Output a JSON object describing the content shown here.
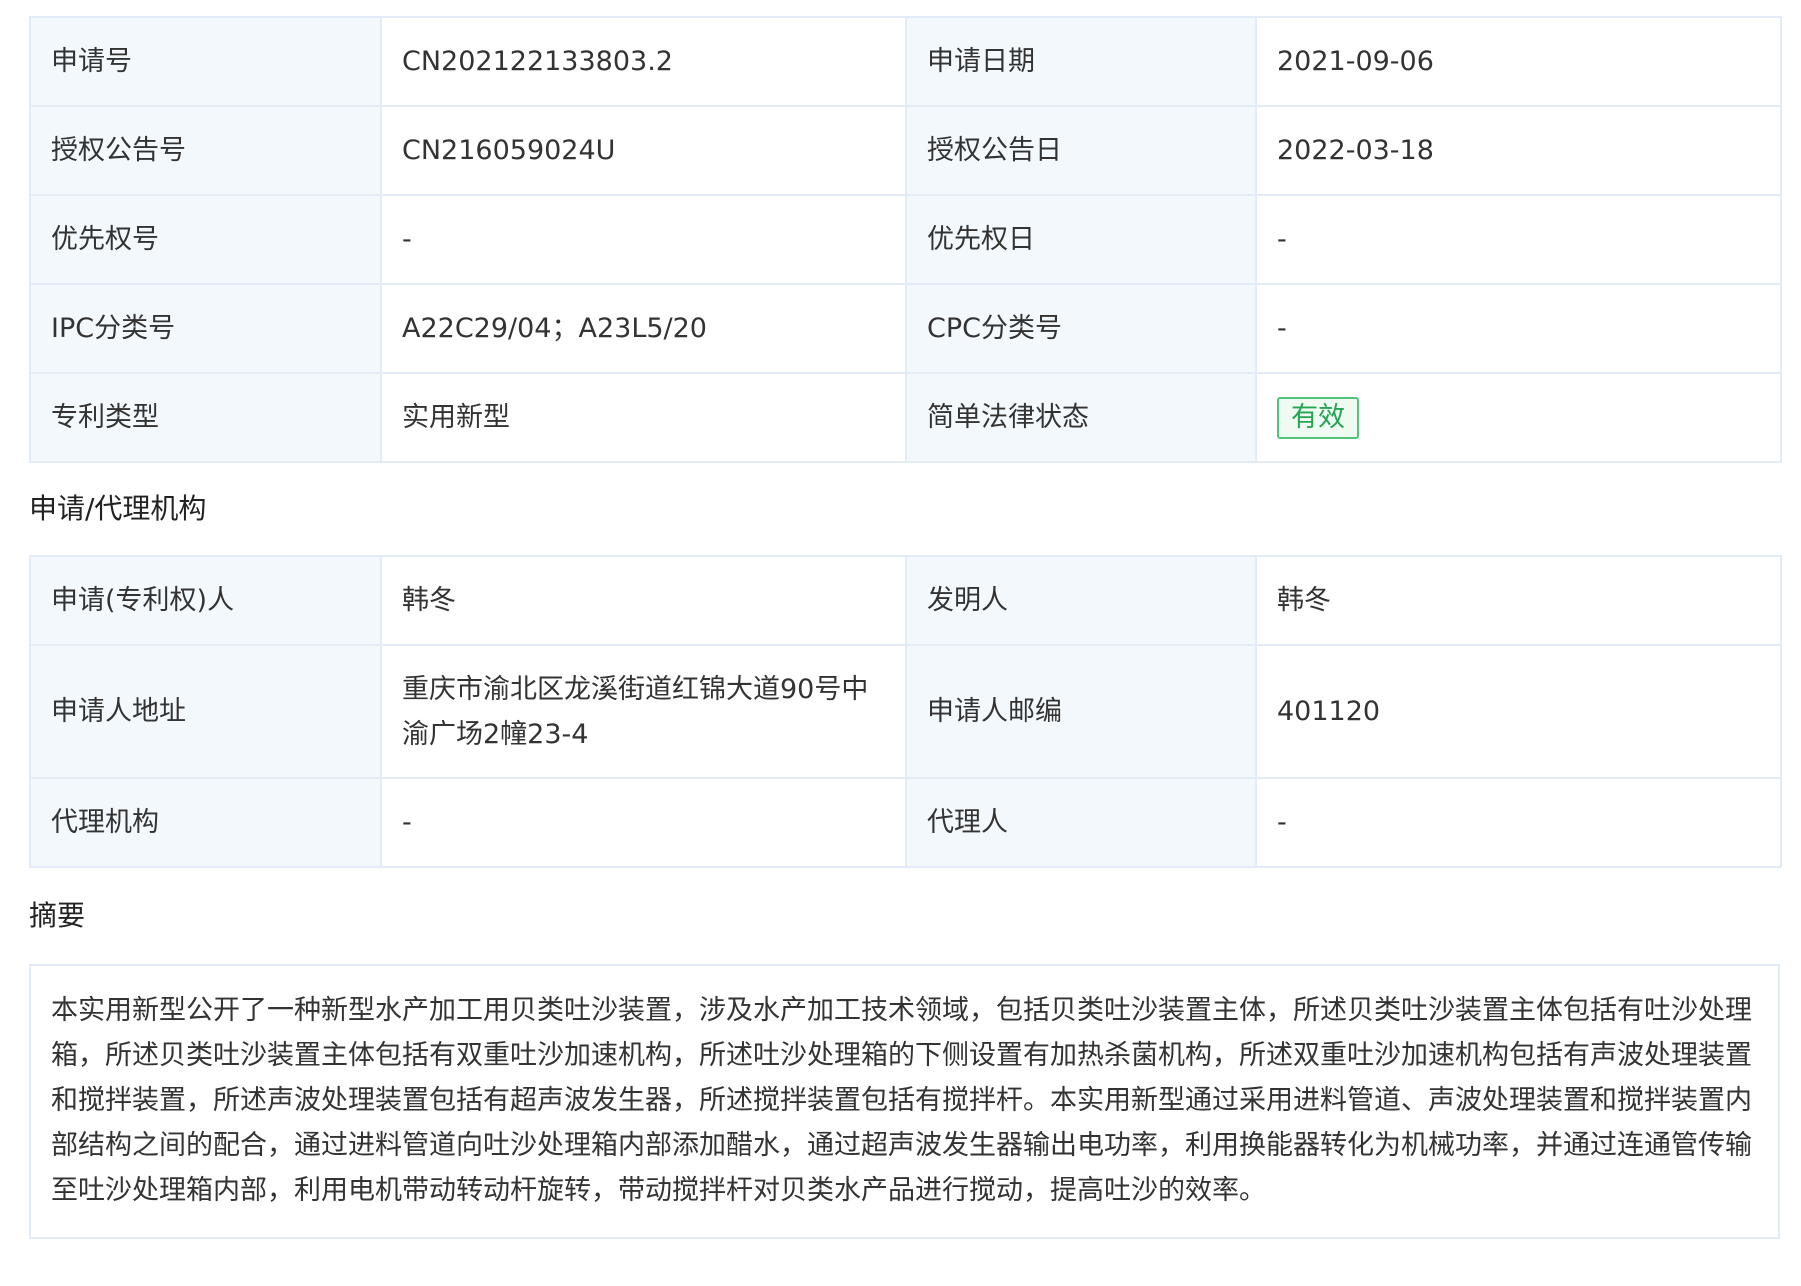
{
  "basic": {
    "rows": [
      {
        "k1": "申请号",
        "v1": "CN202122133803.2",
        "k2": "申请日期",
        "v2": "2021-09-06"
      },
      {
        "k1": "授权公告号",
        "v1": "CN216059024U",
        "k2": "授权公告日",
        "v2": "2022-03-18"
      },
      {
        "k1": "优先权号",
        "v1": "-",
        "k2": "优先权日",
        "v2": "-"
      },
      {
        "k1": "IPC分类号",
        "v1": "A22C29/04；A23L5/20",
        "k2": "CPC分类号",
        "v2": "-"
      },
      {
        "k1": "专利类型",
        "v1": "实用新型",
        "k2": "简单法律状态",
        "v2": "有效"
      }
    ],
    "status_color": "#24a552"
  },
  "applicant_section": {
    "title": "申请/代理机构",
    "rows": [
      {
        "k1": "申请(专利权)人",
        "v1": "韩冬",
        "k2": "发明人",
        "v2": "韩冬"
      },
      {
        "k1": "申请人地址",
        "v1": "重庆市渝北区龙溪街道红锦大道90号中渝广场2幢23-4",
        "k2": "申请人邮编",
        "v2": "401120"
      },
      {
        "k1": "代理机构",
        "v1": "-",
        "k2": "代理人",
        "v2": "-"
      }
    ]
  },
  "abstract_section": {
    "title": "摘要",
    "text": "本实用新型公开了一种新型水产加工用贝类吐沙装置，涉及水产加工技术领域，包括贝类吐沙装置主体，所述贝类吐沙装置主体包括有吐沙处理箱，所述贝类吐沙装置主体包括有双重吐沙加速机构，所述吐沙处理箱的下侧设置有加热杀菌机构，所述双重吐沙加速机构包括有声波处理装置和搅拌装置，所述声波处理装置包括有超声波发生器，所述搅拌装置包括有搅拌杆。本实用新型通过采用进料管道、声波处理装置和搅拌装置内部结构之间的配合，通过进料管道向吐沙处理箱内部添加醋水，通过超声波发生器输出电功率，利用换能器转化为机械功率，并通过连通管传输至吐沙处理箱内部，利用电机带动转动杆旋转，带动搅拌杆对贝类水产品进行搅动，提高吐沙的效率。"
  }
}
